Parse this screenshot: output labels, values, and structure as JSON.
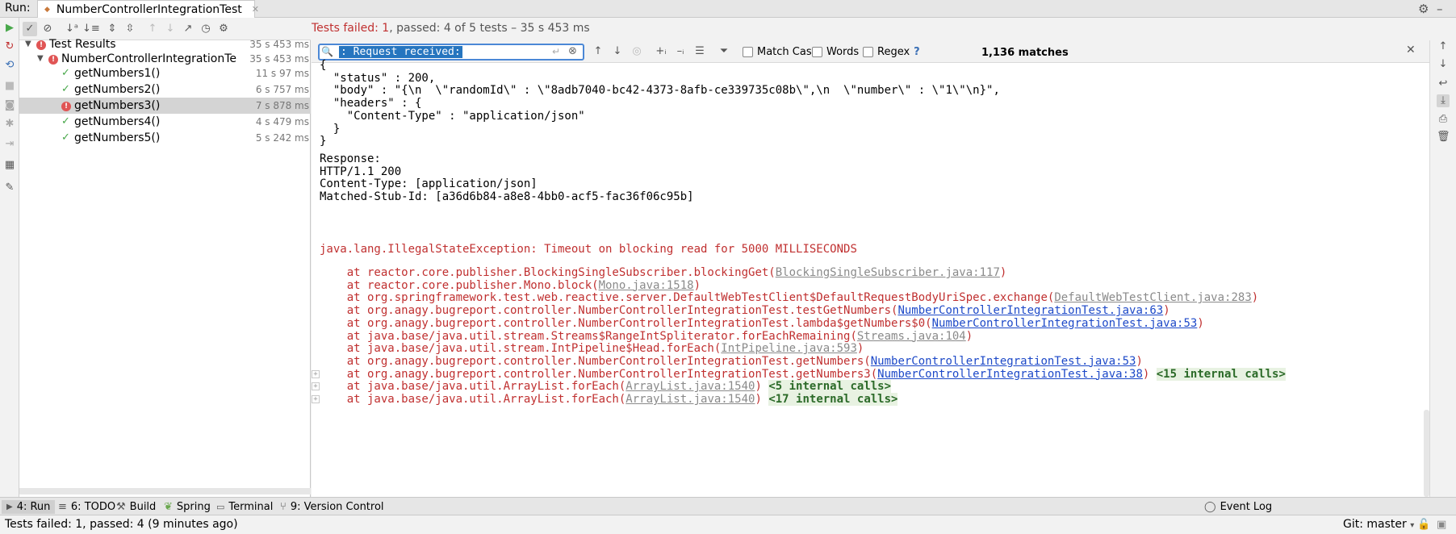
{
  "header": {
    "run_label": "Run:",
    "tab_title": "NumberControllerIntegrationTest",
    "summary_prefix": "Tests failed:",
    "failed_count": "1",
    "summary_suffix": ", passed: 4 of 5 tests – 35 s 453 ms"
  },
  "tree": {
    "rows": [
      {
        "label": "Test Results",
        "time": "35 s 453 ms",
        "status": "failed"
      },
      {
        "label": "NumberControllerIntegrationTe",
        "time": "35 s 453 ms",
        "status": "failed"
      },
      {
        "label": "getNumbers1()",
        "time": "11 s 97 ms",
        "status": "passed"
      },
      {
        "label": "getNumbers2()",
        "time": "6 s 757 ms",
        "status": "passed"
      },
      {
        "label": "getNumbers3()",
        "time": "7 s 878 ms",
        "status": "failed",
        "selected": true
      },
      {
        "label": "getNumbers4()",
        "time": "4 s 479 ms",
        "status": "passed"
      },
      {
        "label": "getNumbers5()",
        "time": "5 s 242 ms",
        "status": "passed"
      }
    ]
  },
  "search": {
    "query": ": Request received:",
    "match_case": "Match Case",
    "words": "Words",
    "regex": "Regex",
    "help": "?",
    "matches": "1,136 matches"
  },
  "console": {
    "json_lines": [
      "{",
      "  \"status\" : 200,",
      "  \"body\" : \"{\\n  \\\"randomId\\\" : \\\"8adb7040-bc42-4373-8afb-ce339735c08b\\\",\\n  \\\"number\\\" : \\\"1\\\"\\n}\",",
      "  \"headers\" : {",
      "    \"Content-Type\" : \"application/json\"",
      "  }",
      "}"
    ],
    "response_lines": [
      "Response:",
      "HTTP/1.1 200",
      "Content-Type: [application/json]",
      "Matched-Stub-Id: [a36d6b84-a8e8-4bb0-acf5-fac36f06c95b]"
    ],
    "exception": "java.lang.IllegalStateException: Timeout on blocking read for 5000 MILLISECONDS",
    "stack": [
      {
        "pre": "    at reactor.core.publisher.BlockingSingleSubscriber.blockingGet(",
        "link": "BlockingSingleSubscriber.java:117",
        "kind": "lib",
        "post": ")",
        "internal": ""
      },
      {
        "pre": "    at reactor.core.publisher.Mono.block(",
        "link": "Mono.java:1518",
        "kind": "lib",
        "post": ")",
        "internal": ""
      },
      {
        "pre": "    at org.springframework.test.web.reactive.server.DefaultWebTestClient$DefaultRequestBodyUriSpec.exchange(",
        "link": "DefaultWebTestClient.java:283",
        "kind": "lib",
        "post": ")",
        "internal": ""
      },
      {
        "pre": "    at org.anagy.bugreport.controller.NumberControllerIntegrationTest.testGetNumbers(",
        "link": "NumberControllerIntegrationTest.java:63",
        "kind": "src",
        "post": ")",
        "internal": ""
      },
      {
        "pre": "    at org.anagy.bugreport.controller.NumberControllerIntegrationTest.lambda$getNumbers$0(",
        "link": "NumberControllerIntegrationTest.java:53",
        "kind": "src",
        "post": ")",
        "internal": ""
      },
      {
        "pre": "    at java.base/java.util.stream.Streams$RangeIntSpliterator.forEachRemaining(",
        "link": "Streams.java:104",
        "kind": "lib",
        "post": ")",
        "internal": ""
      },
      {
        "pre": "    at java.base/java.util.stream.IntPipeline$Head.forEach(",
        "link": "IntPipeline.java:593",
        "kind": "lib",
        "post": ")",
        "internal": ""
      },
      {
        "pre": "    at org.anagy.bugreport.controller.NumberControllerIntegrationTest.getNumbers(",
        "link": "NumberControllerIntegrationTest.java:53",
        "kind": "src",
        "post": ")",
        "internal": ""
      },
      {
        "pre": "    at org.anagy.bugreport.controller.NumberControllerIntegrationTest.getNumbers3(",
        "link": "NumberControllerIntegrationTest.java:38",
        "kind": "src",
        "post": ") ",
        "internal": "<15 internal calls>"
      },
      {
        "pre": "    at java.base/java.util.ArrayList.forEach(",
        "link": "ArrayList.java:1540",
        "kind": "lib",
        "post": ") ",
        "internal": "<5 internal calls>"
      },
      {
        "pre": "    at java.base/java.util.ArrayList.forEach(",
        "link": "ArrayList.java:1540",
        "kind": "lib",
        "post": ") ",
        "internal": "<17 internal calls>"
      }
    ]
  },
  "toolwindows": {
    "run": "4: Run",
    "todo": "6: TODO",
    "build": "Build",
    "spring": "Spring",
    "terminal": "Terminal",
    "vcs": "9: Version Control",
    "event_log": "Event Log"
  },
  "status": {
    "text": "Tests failed: 1, passed: 4 (9 minutes ago)",
    "git": "Git: master"
  },
  "colors": {
    "accent": "#4b88d6",
    "selection": "#2675bf",
    "error": "#c03030",
    "link": "#1d49c8",
    "passed": "#49a84b"
  }
}
